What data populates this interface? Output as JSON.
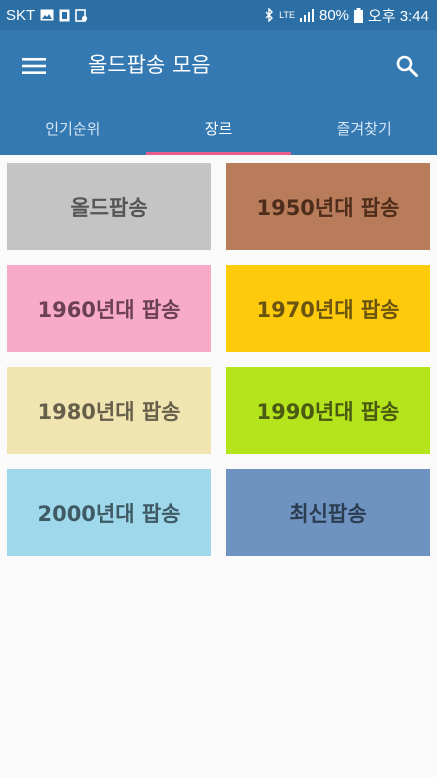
{
  "status_bar": {
    "carrier": "SKT",
    "network": "LTE",
    "battery": "80%",
    "time": "오후 3:44"
  },
  "app_bar": {
    "title": "올드팝송 모음",
    "menu_icon": "hamburger-menu-icon",
    "search_icon": "search-icon"
  },
  "tabs": [
    {
      "label": "인기순위",
      "active": false
    },
    {
      "label": "장르",
      "active": true
    },
    {
      "label": "즐겨찾기",
      "active": false
    }
  ],
  "genres": [
    {
      "label": "올드팝송",
      "bg": "#c4c4c4",
      "color": "#555555"
    },
    {
      "label": "1950년대 팝송",
      "bg": "#b97c5b",
      "color": "#4e2d1b"
    },
    {
      "label": "1960년대 팝송",
      "bg": "#f8aac9",
      "color": "#6b4050"
    },
    {
      "label": "1970년대 팝송",
      "bg": "#fdca0c",
      "color": "#6b5310"
    },
    {
      "label": "1980년대 팝송",
      "bg": "#f0e4b1",
      "color": "#66604a"
    },
    {
      "label": "1990년대 팝송",
      "bg": "#b4e41b",
      "color": "#4b5a12"
    },
    {
      "label": "2000년대 팝송",
      "bg": "#9ed8ea",
      "color": "#3f5a64"
    },
    {
      "label": "최신팝송",
      "bg": "#6e93c1",
      "color": "#2c3d52"
    }
  ]
}
